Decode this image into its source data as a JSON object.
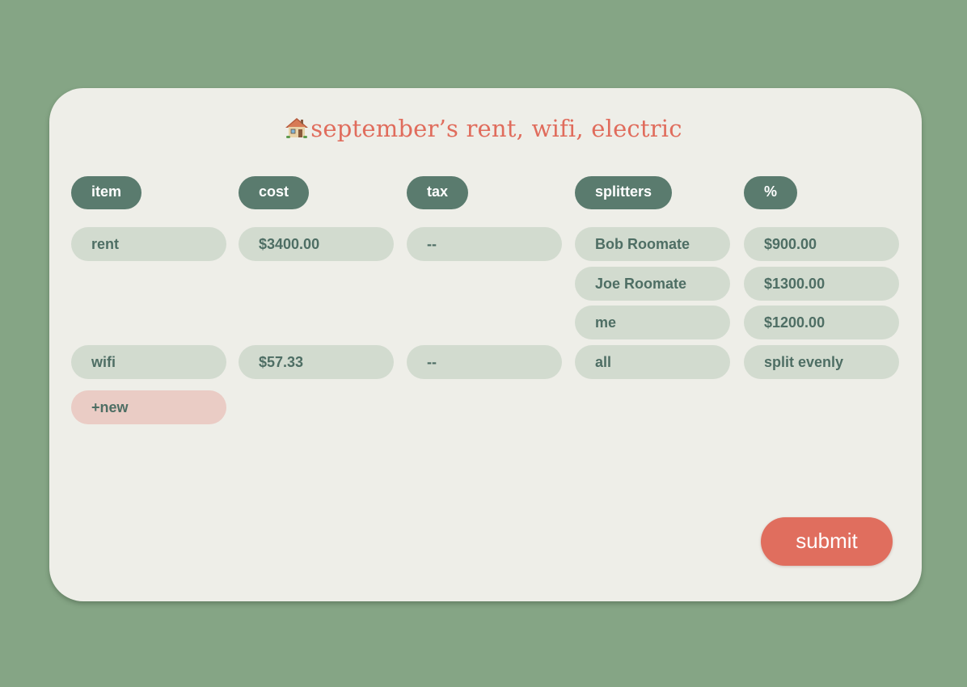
{
  "title": {
    "icon": "house-icon",
    "text": "september’s rent, wifi, electric"
  },
  "headers": {
    "item": "item",
    "cost": "cost",
    "tax": "tax",
    "splitters": "splitters",
    "percent": "%"
  },
  "rows": [
    {
      "item": "rent",
      "cost": "$3400.00",
      "tax": "--",
      "splits": [
        {
          "splitter": "Bob Roomate",
          "amount": "$900.00"
        },
        {
          "splitter": "Joe Roomate",
          "amount": "$1300.00"
        },
        {
          "splitter": "me",
          "amount": "$1200.00"
        }
      ]
    },
    {
      "item": "wifi",
      "cost": "$57.33",
      "tax": "--",
      "splits": [
        {
          "splitter": "all",
          "amount": "split evenly"
        }
      ]
    }
  ],
  "new_label": "+new",
  "submit_label": "submit",
  "colors": {
    "background": "#85a585",
    "card": "#eeeee8",
    "accent": "#e06e5e",
    "header_pill": "#5a7b6e",
    "cell": "#d2dbcf",
    "new_pill": "#eaccc5",
    "cell_text": "#4e6e64"
  }
}
